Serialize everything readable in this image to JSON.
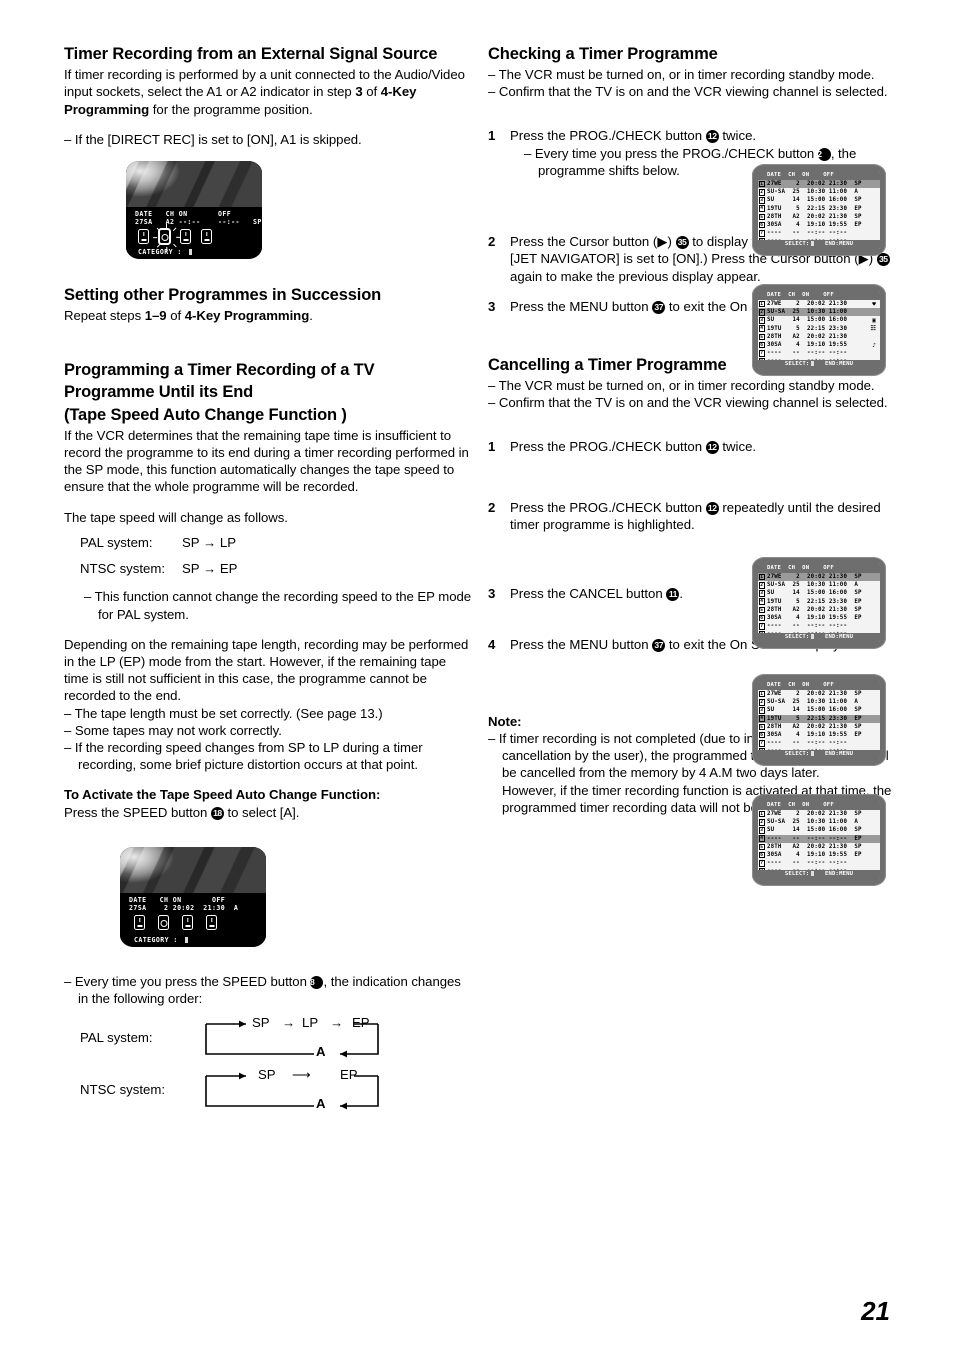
{
  "page": {
    "number": "21"
  },
  "left": {
    "s1": {
      "title": "Timer Recording from an External Signal Source",
      "p1_a": "If timer recording is performed by a unit connected to the Audio/Video input sockets, select the A1 or A2  indicator in step ",
      "p1_b": "3",
      "p1_c": " of ",
      "p1_d": "4-Key Programming",
      "p1_e": " for the programme position.",
      "note": "– If the [DIRECT REC] is set to [ON], A1 is skipped."
    },
    "tv1": {
      "header": "DATE   CH ON       OFF",
      "values": "27SA   A2 --:--    --:--   SP",
      "category_label": "CATEGORY :"
    },
    "s2": {
      "title": "Setting other Programmes in Succession",
      "p_a": "Repeat steps ",
      "p_b": "1–9",
      "p_c": " of ",
      "p_d": "4-Key Programming",
      "p_e": "."
    },
    "s3": {
      "title_l1": "Programming a Timer Recording of a TV",
      "title_l2": "Programme Until its End",
      "title_l3": "(Tape Speed Auto Change Function )",
      "p1": "If the VCR determines that the remaining tape time is insufficient to record the programme to its end during a timer recording performed in the SP mode, this function automatically changes the tape speed to ensure that the whole programme will be recorded.",
      "p2": "The tape speed will change as follows.",
      "speed_rows": [
        {
          "label": "PAL system:",
          "value": "SP → LP"
        },
        {
          "label": "NTSC system:",
          "value": "SP → EP"
        }
      ],
      "note1": "– This function cannot change the recording speed to the EP mode for PAL system.",
      "p3": "Depending on the remaining tape length, recording may be performed in the LP (EP) mode from the start. However, if the remaining tape time is still not sufficient in this case, the programme cannot be recorded to the end.",
      "bullets": [
        "– The tape length must be set correctly. (See page 13.)",
        "– Some tapes may not work correctly.",
        "– If the recording speed changes from SP to LP during a timer recording, some brief picture distortion occurs at that point."
      ],
      "activate_title": "To Activate the Tape Speed Auto Change Function:",
      "activate_a": "Press the SPEED button ",
      "activate_btn": "18",
      "activate_b": " to select [A]."
    },
    "tv2": {
      "header": "DATE   CH ON       OFF",
      "values": "27SA    2 20:02  21:30  A",
      "category_label": "CATEGORY :"
    },
    "s4": {
      "note_a": "– Every time you press the SPEED button ",
      "note_btn": "18",
      "note_b": ", the indication changes in the following order:",
      "cycles": [
        {
          "label": "PAL system:",
          "terms": [
            "SP",
            "LP",
            "EP"
          ],
          "return": "A"
        },
        {
          "label": "NTSC system:",
          "terms": [
            "SP",
            "EP"
          ],
          "return": "A"
        }
      ]
    }
  },
  "right": {
    "check": {
      "title": "Checking a Timer Programme",
      "pre": [
        "– The VCR must be turned on, or in timer recording standby mode.",
        "– Confirm that the TV is on and the VCR viewing channel is selected."
      ],
      "steps": [
        {
          "num": "1",
          "a": "Press the PROG./CHECK button ",
          "btn": "12",
          "b": " twice.",
          "sub_a": "– Every time you press the PROG./CHECK button ",
          "sub_btn": "12",
          "sub_b": ", the programme shifts below."
        },
        {
          "num": "2",
          "a": "Press the Cursor button (▶) ",
          "btn": "35",
          "b": " to display the Category. (When [JET NAVIGATOR] is set to [ON].) Press the Cursor button (▶) ",
          "btn2": "35",
          "c": " again to make the previous display appear."
        },
        {
          "num": "3",
          "a": "Press the MENU button ",
          "btn": "37",
          "b": " to exit the On Screen Display."
        }
      ]
    },
    "cancel": {
      "title": "Cancelling a Timer Programme",
      "pre": [
        "– The VCR must be turned on, or in timer recording standby mode.",
        "– Confirm that the TV is on and the VCR viewing channel is selected."
      ],
      "steps": [
        {
          "num": "1",
          "a": "Press the PROG./CHECK button ",
          "btn": "12",
          "b": " twice."
        },
        {
          "num": "2",
          "a": "Press the PROG./CHECK button ",
          "btn": "12",
          "b": " repeatedly until the desired timer programme is highlighted."
        },
        {
          "num": "3",
          "a": "Press the CANCEL button ",
          "btn": "11",
          "b": "."
        },
        {
          "num": "4",
          "a": "Press the MENU button ",
          "btn": "37",
          "b": " to exit the On Screen Display."
        }
      ]
    },
    "note": {
      "title": "Note:",
      "lines": [
        "– If timer recording is not completed (due to insufficient tape or cancellation by the user), the programmed timer recording data will be cancelled from the memory by 4 A.M two days later.",
        "However, if the timer recording function is activated at that time, the programmed timer recording data will not be cancelled."
      ]
    }
  },
  "osd_lists": {
    "header": "DATE  CH  ON    OFF",
    "footer_a": "SELECT:",
    "footer_b": "   END:MENU",
    "list1": {
      "highlight": 1,
      "rows": [
        {
          "idx": "1",
          "text": "27WE    2  20:02 21:30  SP"
        },
        {
          "idx": "2",
          "text": "SU-SA  25  10:30 11:00  A"
        },
        {
          "idx": "3",
          "text": "SU     14  15:00 16:00  SP"
        },
        {
          "idx": "4",
          "text": "19TU    5  22:15 23:30  EP"
        },
        {
          "idx": "5",
          "text": "28TH   A2  20:02 21:30  SP"
        },
        {
          "idx": "6",
          "text": "30SA    4  19:10 19:55  EP"
        },
        {
          "idx": "7",
          "text": "----   --  --:-- --:--"
        },
        {
          "idx": "8",
          "text": "----   --  --:-- --:--"
        }
      ]
    },
    "list2": {
      "highlight": 2,
      "rows": [
        {
          "idx": "1",
          "text": "27WE    2  20:02 21:30",
          "icon": "♥"
        },
        {
          "idx": "2",
          "text": "SU-SA  25  10:30 11:00",
          "icon": ""
        },
        {
          "idx": "3",
          "text": "SU     14  15:00 16:00",
          "icon": "▣"
        },
        {
          "idx": "4",
          "text": "19TU    5  22:15 23:30",
          "icon": "☷"
        },
        {
          "idx": "5",
          "text": "28TH   A2  20:02 21:30",
          "icon": ""
        },
        {
          "idx": "6",
          "text": "30SA    4  19:10 19:55",
          "icon": "♪"
        },
        {
          "idx": "7",
          "text": "----   --  --:-- --:--",
          "icon": ""
        },
        {
          "idx": "8",
          "text": "----   --  --:-- --:--",
          "icon": ""
        }
      ]
    },
    "list3": {
      "highlight": 1,
      "rows": [
        {
          "idx": "1",
          "text": "27WE    2  20:02 21:30  SP"
        },
        {
          "idx": "2",
          "text": "SU-SA  25  10:30 11:00  A"
        },
        {
          "idx": "3",
          "text": "SU     14  15:00 16:00  SP"
        },
        {
          "idx": "4",
          "text": "19TU    5  22:15 23:30  EP"
        },
        {
          "idx": "5",
          "text": "28TH   A2  20:02 21:30  SP"
        },
        {
          "idx": "6",
          "text": "30SA    4  19:10 19:55  EP"
        },
        {
          "idx": "7",
          "text": "----   --  --:-- --:--"
        },
        {
          "idx": "8",
          "text": "----   --  --:-- --:--"
        }
      ]
    },
    "list4": {
      "highlight": 4,
      "rows": [
        {
          "idx": "1",
          "text": "27WE    2  20:02 21:30  SP"
        },
        {
          "idx": "2",
          "text": "SU-SA  25  10:30 11:00  A"
        },
        {
          "idx": "3",
          "text": "SU     14  15:00 16:00  SP"
        },
        {
          "idx": "4",
          "text": "19TU    5  22:15 23:30  EP"
        },
        {
          "idx": "5",
          "text": "28TH   A2  20:02 21:30  SP"
        },
        {
          "idx": "6",
          "text": "30SA    4  19:10 19:55  EP"
        },
        {
          "idx": "7",
          "text": "----   --  --:-- --:--"
        },
        {
          "idx": "8",
          "text": "----   --  --:-- --:--"
        }
      ]
    },
    "list5": {
      "highlight": 4,
      "rows": [
        {
          "idx": "1",
          "text": "27WE    2  20:02 21:30  SP"
        },
        {
          "idx": "2",
          "text": "SU-SA  25  10:30 11:00  A"
        },
        {
          "idx": "3",
          "text": "SU     14  15:00 16:00  SP"
        },
        {
          "idx": "4",
          "text": "----   --  --:-- --:--  EP"
        },
        {
          "idx": "5",
          "text": "28TH   A2  20:02 21:30  SP"
        },
        {
          "idx": "6",
          "text": "30SA    4  19:10 19:55  EP"
        },
        {
          "idx": "7",
          "text": "----   --  --:-- --:--"
        },
        {
          "idx": "8",
          "text": "----   --  --:-- --:--"
        }
      ]
    }
  }
}
